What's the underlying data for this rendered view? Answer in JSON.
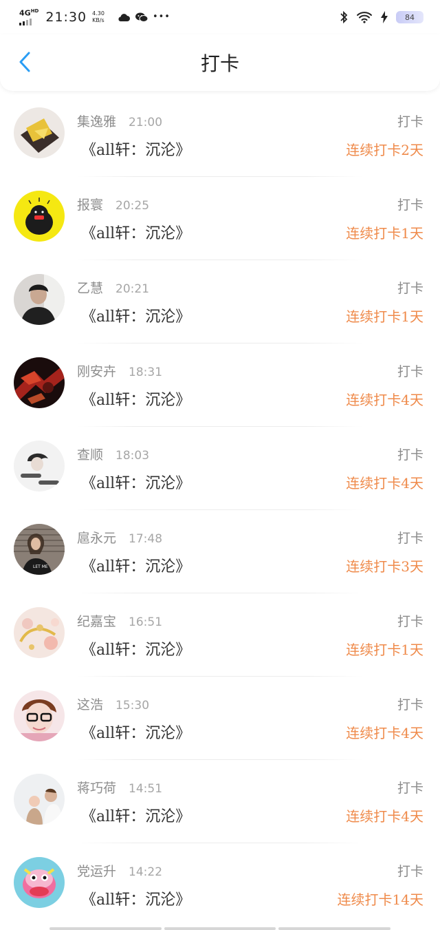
{
  "status_bar": {
    "network": "4G",
    "network_sup": "HD",
    "time": "21:30",
    "speed_value": "4.30",
    "speed_unit": "KB/s",
    "more": "•••",
    "battery": "84"
  },
  "header": {
    "title": "打卡"
  },
  "items": [
    {
      "name": "集逸雅",
      "time": "21:00",
      "book": "《all轩：沉沦》",
      "action": "打卡",
      "streak": "连续打卡2天"
    },
    {
      "name": "报寰",
      "time": "20:25",
      "book": "《all轩：沉沦》",
      "action": "打卡",
      "streak": "连续打卡1天"
    },
    {
      "name": "乙慧",
      "time": "20:21",
      "book": "《all轩：沉沦》",
      "action": "打卡",
      "streak": "连续打卡1天"
    },
    {
      "name": "刚安卉",
      "time": "18:31",
      "book": "《all轩：沉沦》",
      "action": "打卡",
      "streak": "连续打卡4天"
    },
    {
      "name": "查顺",
      "time": "18:03",
      "book": "《all轩：沉沦》",
      "action": "打卡",
      "streak": "连续打卡4天"
    },
    {
      "name": "扈永元",
      "time": "17:48",
      "book": "《all轩：沉沦》",
      "action": "打卡",
      "streak": "连续打卡3天"
    },
    {
      "name": "纪嘉宝",
      "time": "16:51",
      "book": "《all轩：沉沦》",
      "action": "打卡",
      "streak": "连续打卡1天"
    },
    {
      "name": "这浩",
      "time": "15:30",
      "book": "《all轩：沉沦》",
      "action": "打卡",
      "streak": "连续打卡4天"
    },
    {
      "name": "蒋巧荷",
      "time": "14:51",
      "book": "《all轩：沉沦》",
      "action": "打卡",
      "streak": "连续打卡4天"
    },
    {
      "name": "党运升",
      "time": "14:22",
      "book": "《all轩：沉沦》",
      "action": "打卡",
      "streak": "连续打卡14天"
    }
  ],
  "colors": {
    "accent_blue": "#2a9df4",
    "streak_orange": "#ef8a4a",
    "muted_text": "#8e8e8e"
  }
}
